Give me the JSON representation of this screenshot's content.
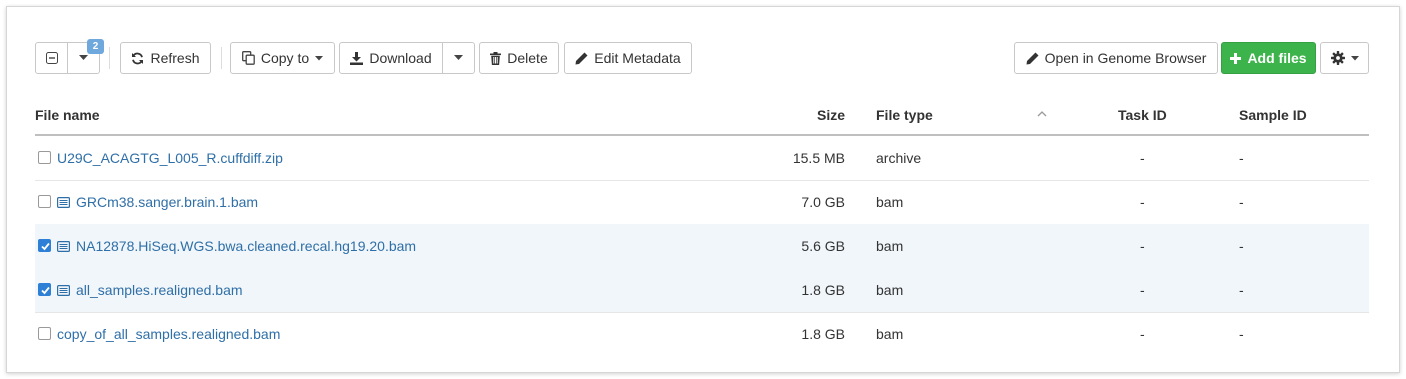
{
  "toolbar": {
    "selection_count": "2",
    "refresh_label": "Refresh",
    "copy_to_label": "Copy to",
    "download_label": "Download",
    "delete_label": "Delete",
    "edit_metadata_label": "Edit Metadata",
    "open_genome_browser_label": "Open in Genome Browser",
    "add_files_label": "Add files"
  },
  "table": {
    "headers": {
      "file_name": "File name",
      "size": "Size",
      "file_type": "File type",
      "task_id": "Task ID",
      "sample_id": "Sample ID"
    },
    "rows": [
      {
        "name": "U29C_ACAGTG_L005_R.cuffdiff.zip",
        "size": "15.5 MB",
        "type": "archive",
        "task_id": "-",
        "sample_id": "-",
        "checked": false,
        "icon": "none"
      },
      {
        "name": "GRCm38.sanger.brain.1.bam",
        "size": "7.0 GB",
        "type": "bam",
        "task_id": "-",
        "sample_id": "-",
        "checked": false,
        "icon": "list-icon"
      },
      {
        "name": "NA12878.HiSeq.WGS.bwa.cleaned.recal.hg19.20.bam",
        "size": "5.6 GB",
        "type": "bam",
        "task_id": "-",
        "sample_id": "-",
        "checked": true,
        "icon": "list-icon"
      },
      {
        "name": "all_samples.realigned.bam",
        "size": "1.8 GB",
        "type": "bam",
        "task_id": "-",
        "sample_id": "-",
        "checked": true,
        "icon": "list-icon"
      },
      {
        "name": "copy_of_all_samples.realigned.bam",
        "size": "1.8 GB",
        "type": "bam",
        "task_id": "-",
        "sample_id": "-",
        "checked": false,
        "icon": "none"
      }
    ]
  },
  "colors": {
    "accent_green": "#3cb44b",
    "link_blue": "#2f6fa7",
    "checkbox_blue": "#2e7fd6",
    "selected_row": "#f1f6fa",
    "badge_blue": "#6fa8dc"
  }
}
